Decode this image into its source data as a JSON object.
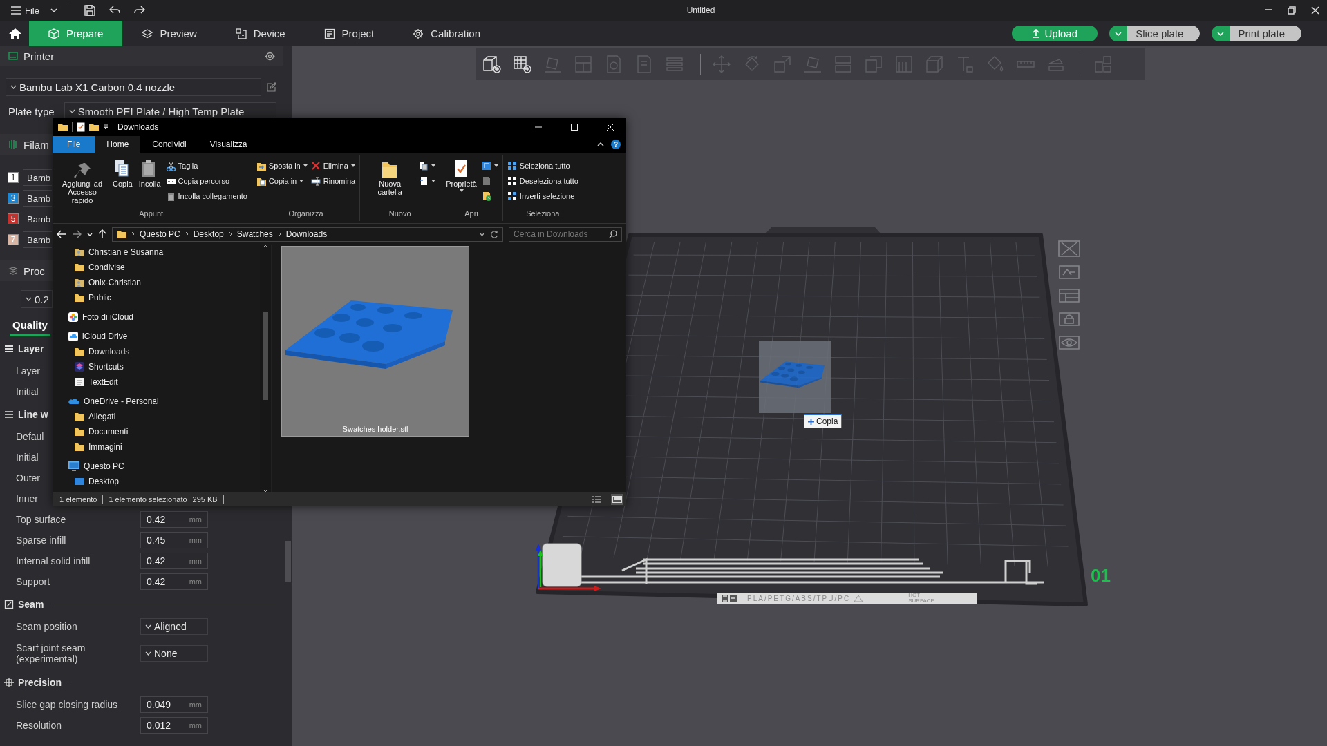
{
  "app": {
    "menu": "File",
    "title": "Untitled"
  },
  "main_tabs": [
    {
      "label": "Prepare",
      "kind": "prepare",
      "selected": true
    },
    {
      "label": "Preview",
      "kind": "preview",
      "selected": false
    },
    {
      "label": "Device",
      "kind": "device",
      "selected": false
    },
    {
      "label": "Project",
      "kind": "project",
      "selected": false
    },
    {
      "label": "Calibration",
      "kind": "calibration",
      "selected": false
    }
  ],
  "actions": [
    {
      "label": "Upload",
      "kind": "upload"
    },
    {
      "label": "Slice plate",
      "kind": "split"
    },
    {
      "label": "Print plate",
      "kind": "split"
    }
  ],
  "sidebar": {
    "printer": {
      "title": "Printer",
      "preset": "Bambu Lab X1 Carbon 0.4 nozzle",
      "plate_label": "Plate type",
      "plate": "Smooth PEI Plate / High Temp Plate"
    },
    "filament": {
      "title": "Filam",
      "slots": [
        {
          "number": "1",
          "color": "#ffffff",
          "name": "Bamb"
        },
        {
          "number": "3",
          "color": "#1a86d6",
          "name": "Bamb"
        },
        {
          "number": "5",
          "color": "#c9302c",
          "name": "Bamb"
        },
        {
          "number": "7",
          "color": "#d8b5a2",
          "name": "Bamb"
        }
      ]
    },
    "process": {
      "title": "Proc",
      "preset": "0.2",
      "tabs": [
        {
          "label": "Quality",
          "selected": true
        }
      ]
    },
    "sections": [
      {
        "title": "Layer",
        "kind": "layer",
        "rows": [
          {
            "kind": "label",
            "label": "Layer"
          },
          {
            "kind": "label",
            "label": "Initial"
          }
        ]
      },
      {
        "title": "Line w",
        "kind": "line",
        "rows": [
          {
            "kind": "label",
            "label": "Defaul"
          },
          {
            "kind": "label",
            "label": "Initial"
          },
          {
            "kind": "label",
            "label": "Outer"
          },
          {
            "kind": "label",
            "label": "Inner"
          },
          {
            "kind": "number",
            "label": "Top surface",
            "value": "0.42",
            "unit": "mm"
          },
          {
            "kind": "number",
            "label": "Sparse infill",
            "value": "0.45",
            "unit": "mm"
          },
          {
            "kind": "number",
            "label": "Internal solid infill",
            "value": "0.42",
            "unit": "mm"
          },
          {
            "kind": "number",
            "label": "Support",
            "value": "0.42",
            "unit": "mm"
          }
        ]
      },
      {
        "title": "Seam",
        "kind": "seam",
        "rows": [
          {
            "kind": "select",
            "label": "Seam position",
            "value": "Aligned"
          },
          {
            "kind": "select",
            "label": "Scarf joint seam (experimental)",
            "value": "None"
          }
        ]
      },
      {
        "title": "Precision",
        "kind": "precision",
        "rows": [
          {
            "kind": "number",
            "label": "Slice gap closing radius",
            "value": "0.049",
            "unit": "mm"
          },
          {
            "kind": "number",
            "label": "Resolution",
            "value": "0.012",
            "unit": "mm"
          }
        ]
      }
    ]
  },
  "toolbar": [
    {
      "kind": "add-cube",
      "disabled": false
    },
    {
      "kind": "add-plate",
      "disabled": false
    },
    {
      "kind": "orient",
      "disabled": true
    },
    {
      "kind": "arrange",
      "disabled": true
    },
    {
      "kind": "page-o",
      "disabled": true
    },
    {
      "kind": "page",
      "disabled": true
    },
    {
      "kind": "stack",
      "disabled": true
    },
    {
      "kind": "separator"
    },
    {
      "kind": "move",
      "disabled": true
    },
    {
      "kind": "rotate",
      "disabled": true
    },
    {
      "kind": "scale",
      "disabled": true
    },
    {
      "kind": "lay-flat",
      "disabled": true
    },
    {
      "kind": "split",
      "disabled": true
    },
    {
      "kind": "overlap",
      "disabled": true
    },
    {
      "kind": "support",
      "disabled": true
    },
    {
      "kind": "cube",
      "disabled": true
    },
    {
      "kind": "text",
      "disabled": true
    },
    {
      "kind": "bucket",
      "disabled": true
    },
    {
      "kind": "ruler",
      "disabled": true
    },
    {
      "kind": "assembly",
      "disabled": true
    },
    {
      "kind": "separator"
    },
    {
      "kind": "explode",
      "disabled": true
    }
  ],
  "plate": {
    "number": "01",
    "material": "PLA/PETG/ABS/TPU/PC",
    "warning": "HOT SURFACE"
  },
  "drag": {
    "label": "Copia"
  },
  "explorer": {
    "title": "Downloads",
    "help": "?",
    "tabs": [
      {
        "label": "File",
        "kind": "file",
        "selected": false
      },
      {
        "label": "Home",
        "kind": "tab",
        "selected": true
      },
      {
        "label": "Condividi",
        "kind": "tab",
        "selected": false
      },
      {
        "label": "Visualizza",
        "kind": "tab",
        "selected": false
      }
    ],
    "ribbon": [
      {
        "label": "Appunti",
        "columns": [
          {
            "kind": "large",
            "tools": [
              {
                "label": "Aggiungi ad Accesso rapido",
                "kind": "pin",
                "dropdown": false
              }
            ]
          },
          {
            "kind": "large",
            "tools": [
              {
                "label": "Copia",
                "kind": "copy",
                "dropdown": false
              }
            ]
          },
          {
            "kind": "large",
            "tools": [
              {
                "label": "Incolla",
                "kind": "paste",
                "dropdown": false
              }
            ]
          },
          {
            "kind": "small",
            "tools": [
              {
                "label": "Taglia",
                "kind": "cut",
                "dropdown": false
              },
              {
                "label": "Copia percorso",
                "kind": "path",
                "dropdown": false
              },
              {
                "label": "Incolla collegamento",
                "kind": "paste-link",
                "dropdown": false
              }
            ]
          }
        ]
      },
      {
        "label": "Organizza",
        "columns": [
          {
            "kind": "small",
            "tools": [
              {
                "label": "Sposta in",
                "kind": "move-to",
                "dropdown": true
              },
              {
                "label": "Copia in",
                "kind": "copy-to",
                "dropdown": true
              }
            ]
          },
          {
            "kind": "small",
            "tools": [
              {
                "label": "Elimina",
                "kind": "delete",
                "dropdown": true
              },
              {
                "label": "Rinomina",
                "kind": "rename",
                "dropdown": false
              }
            ]
          }
        ]
      },
      {
        "label": "Nuovo",
        "columns": [
          {
            "kind": "large",
            "tools": [
              {
                "label": "Nuova cartella",
                "kind": "folder",
                "dropdown": false
              }
            ]
          },
          {
            "kind": "small",
            "tools": [
              {
                "kind": "new-item",
                "dropdown": true
              },
              {
                "kind": "easy-access",
                "dropdown": true
              }
            ]
          }
        ]
      },
      {
        "label": "Apri",
        "columns": [
          {
            "kind": "large",
            "tools": [
              {
                "label": "Proprietà",
                "kind": "properties",
                "dropdown": true
              }
            ]
          },
          {
            "kind": "small",
            "tools": [
              {
                "kind": "open",
                "dropdown": true
              },
              {
                "kind": "edit",
                "dropdown": false
              },
              {
                "kind": "history",
                "dropdown": false
              }
            ]
          }
        ]
      },
      {
        "label": "Seleziona",
        "columns": [
          {
            "kind": "small",
            "tools": [
              {
                "label": "Seleziona tutto",
                "kind": "select-all",
                "dropdown": false
              },
              {
                "label": "Deseleziona tutto",
                "kind": "select-none",
                "dropdown": false
              },
              {
                "label": "Inverti selezione",
                "kind": "invert",
                "dropdown": false
              }
            ]
          }
        ]
      }
    ],
    "path": [
      "Questo PC",
      "Desktop",
      "Swatches",
      "Downloads"
    ],
    "search": {
      "placeholder": "Cerca in Downloads"
    },
    "nav": [
      {
        "children": [
          {
            "label": "Christian e Susanna",
            "kind": "user"
          },
          {
            "label": "Condivise",
            "kind": "folder"
          },
          {
            "label": "Onix-Christian",
            "kind": "user"
          },
          {
            "label": "Public",
            "kind": "folder"
          }
        ]
      },
      {
        "label": "Foto di iCloud",
        "kind": "photos"
      },
      {
        "label": "iCloud Drive",
        "kind": "icloud",
        "children": [
          {
            "label": "Downloads",
            "kind": "folder"
          },
          {
            "label": "Shortcuts",
            "kind": "shortcuts"
          },
          {
            "label": "TextEdit",
            "kind": "textedit"
          }
        ]
      },
      {
        "label": "OneDrive - Personal",
        "kind": "onedrive",
        "children": [
          {
            "label": "Allegati",
            "kind": "folder"
          },
          {
            "label": "Documenti",
            "kind": "folder"
          },
          {
            "label": "Immagini",
            "kind": "folder"
          }
        ]
      },
      {
        "label": "Questo PC",
        "kind": "pc",
        "children": [
          {
            "label": "Desktop",
            "kind": "desktop"
          }
        ]
      }
    ],
    "files": [
      {
        "name": "Swatches holder.stl",
        "kind": "picture",
        "selected": true
      }
    ],
    "status": {
      "count": "1 elemento",
      "selection": "1 elemento selezionato",
      "size": "295 KB"
    },
    "views": [
      {
        "kind": "details",
        "selected": false
      },
      {
        "kind": "large-icons",
        "selected": true
      }
    ]
  }
}
